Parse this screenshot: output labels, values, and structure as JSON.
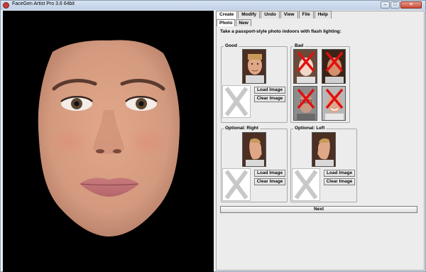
{
  "window": {
    "title": "FaceGen Artist Pro 3.6 64bit"
  },
  "menu_tabs": [
    {
      "label": "Create",
      "active": true
    },
    {
      "label": "Modify",
      "active": false
    },
    {
      "label": "Undo",
      "active": false
    },
    {
      "label": "View",
      "active": false
    },
    {
      "label": "File",
      "active": false
    },
    {
      "label": "Help",
      "active": false
    }
  ],
  "sub_tabs": [
    {
      "label": "Photo",
      "active": true
    },
    {
      "label": "New",
      "active": false
    }
  ],
  "instructions": "Take a passport-style photo indoors with flash lighting:",
  "groups": {
    "good": {
      "title": "Good"
    },
    "bad": {
      "title": "Bad"
    },
    "optional_right": {
      "title": "Optional: Right"
    },
    "optional_left": {
      "title": "Optional: Left"
    }
  },
  "buttons": {
    "load_image": "Load Image",
    "clear_image": "Clear Image",
    "next": "Next"
  },
  "colors": {
    "reject_mark": "#e01010",
    "placeholder_x": "#c8c8c8"
  }
}
